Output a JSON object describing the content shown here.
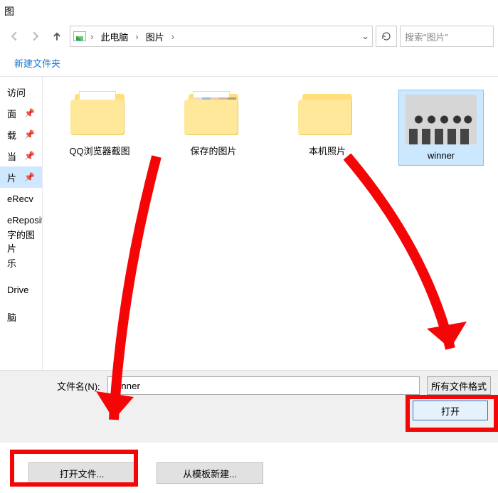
{
  "title": "图",
  "breadcrumb": {
    "root": "此电脑",
    "folder": "图片"
  },
  "search": {
    "placeholder": "搜索\"图片\""
  },
  "toolbar": {
    "new_folder": "新建文件夹"
  },
  "sidebar": {
    "items": [
      {
        "label": "访问"
      },
      {
        "label": "面"
      },
      {
        "label": "载"
      },
      {
        "label": "当"
      },
      {
        "label": "片",
        "selected": true
      },
      {
        "label": "eRecv"
      },
      {
        "label": "eRepository"
      },
      {
        "label": "字的图片"
      },
      {
        "label": "乐"
      },
      {
        "label": "Drive"
      },
      {
        "label": "脑"
      }
    ]
  },
  "files": [
    {
      "label": "QQ浏览器截图",
      "type": "folder-doc"
    },
    {
      "label": "保存的图片",
      "type": "folder-people"
    },
    {
      "label": "本机照片",
      "type": "folder"
    },
    {
      "label": "winner",
      "type": "image",
      "selected": true
    }
  ],
  "filename_label": "文件名(N):",
  "filename_value": "winner",
  "filter_label": "所有文件格式",
  "open_button": "打开",
  "lower_buttons": {
    "open_file": "打开文件...",
    "from_template": "从模板新建..."
  }
}
